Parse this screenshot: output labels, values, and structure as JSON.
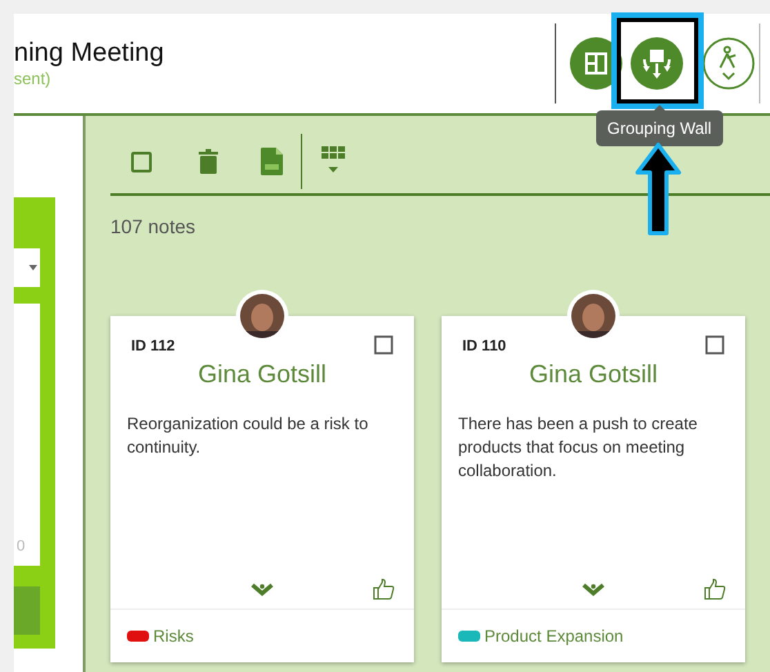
{
  "header": {
    "title": "ning Meeting",
    "subtitle": "sent)"
  },
  "header_buttons": [
    {
      "kind": "board",
      "highlighted": false
    },
    {
      "kind": "grouping",
      "highlighted": true
    },
    {
      "kind": "person",
      "highlighted": false
    }
  ],
  "tooltip": "Grouping Wall",
  "sidebar": {
    "field_value": "0"
  },
  "notes_count": "107 notes",
  "notes": [
    {
      "id": "ID 112",
      "author": "Gina Gotsill",
      "text": "Reorganization could be a risk to continuity.",
      "checked": false,
      "category": {
        "label": "Risks",
        "color": "#e01010"
      }
    },
    {
      "id": "ID 110",
      "author": "Gina Gotsill",
      "text": "There has been a push to create products that focus on meeting collaboration.",
      "checked": false,
      "category": {
        "label": "Product Expansion",
        "color": "#1ab8b8"
      }
    }
  ]
}
